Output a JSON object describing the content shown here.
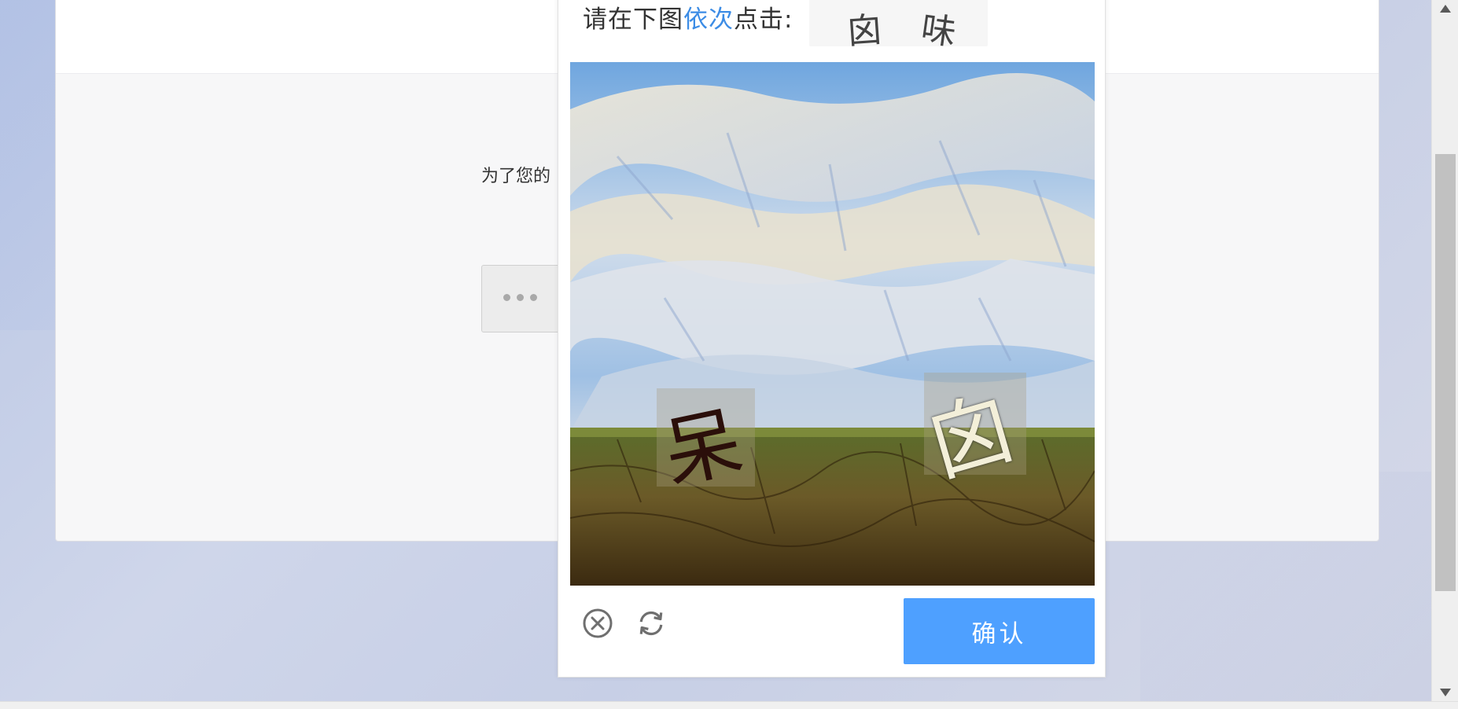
{
  "page": {
    "notice_text": "为了您的"
  },
  "captcha": {
    "instruction_prefix": "请在下图",
    "instruction_highlight": "依次",
    "instruction_suffix": "点击:",
    "target_chars": [
      "囟",
      "味"
    ],
    "image_chars": [
      "呆",
      "囟"
    ],
    "confirm_label": "确认",
    "close_icon": "close-circle-icon",
    "refresh_icon": "refresh-icon"
  },
  "colors": {
    "highlight": "#3c8ce5",
    "confirm_bg": "#4ea0ff"
  }
}
